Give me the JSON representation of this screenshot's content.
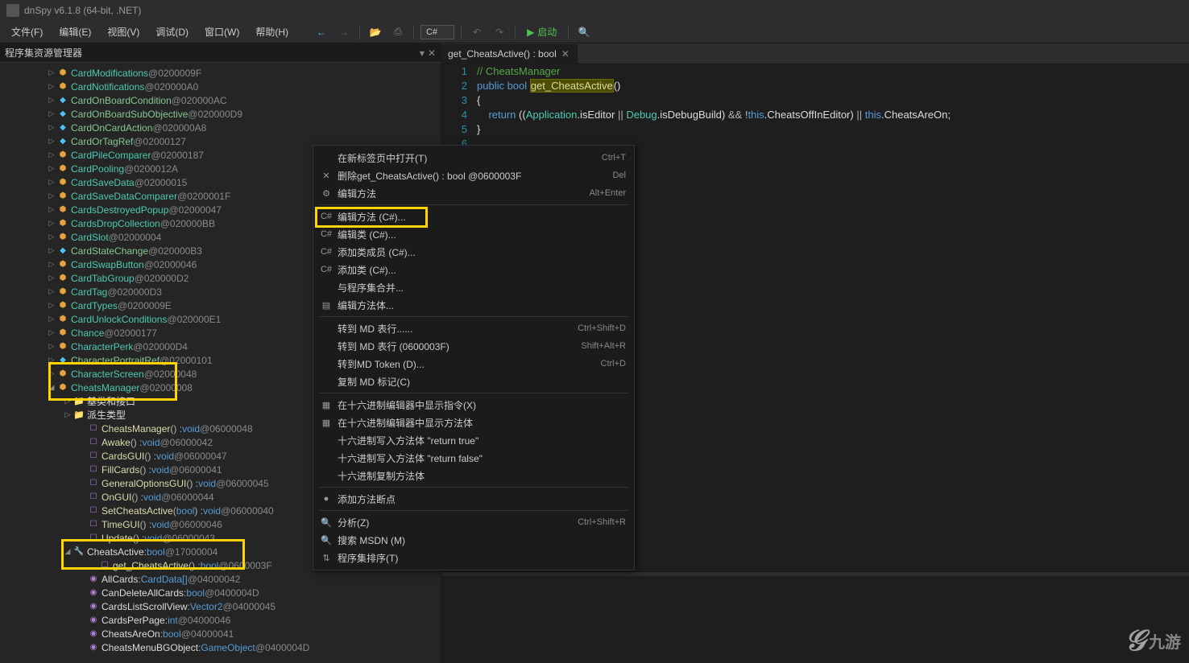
{
  "title": "dnSpy v6.1.8 (64-bit, .NET)",
  "menu": {
    "file": "文件(F)",
    "edit": "编辑(E)",
    "view": "视图(V)",
    "debug": "调试(D)",
    "window": "窗口(W)",
    "help": "帮助(H)"
  },
  "toolbar": {
    "lang": "C#",
    "start": "启动"
  },
  "sidebar": {
    "title": "程序集资源管理器"
  },
  "tree": [
    {
      "i": 58,
      "a": "▷",
      "t": "class",
      "n": "CardModifications",
      "m": "@0200009F"
    },
    {
      "i": 58,
      "a": "▷",
      "t": "class",
      "n": "CardNotifications",
      "m": "@020000A0"
    },
    {
      "i": 58,
      "a": "▷",
      "t": "struct",
      "n": "CardOnBoardCondition",
      "m": "@020000AC"
    },
    {
      "i": 58,
      "a": "▷",
      "t": "struct",
      "n": "CardOnBoardSubObjective",
      "m": "@020000D9"
    },
    {
      "i": 58,
      "a": "▷",
      "t": "struct",
      "n": "CardOnCardAction",
      "m": "@020000A8"
    },
    {
      "i": 58,
      "a": "▷",
      "t": "struct",
      "n": "CardOrTagRef",
      "m": "@02000127"
    },
    {
      "i": 58,
      "a": "▷",
      "t": "class",
      "n": "CardPileComparer",
      "m": "@02000187"
    },
    {
      "i": 58,
      "a": "▷",
      "t": "class",
      "n": "CardPooling",
      "m": "@0200012A"
    },
    {
      "i": 58,
      "a": "▷",
      "t": "class",
      "n": "CardSaveData",
      "m": "@02000015"
    },
    {
      "i": 58,
      "a": "▷",
      "t": "class",
      "n": "CardSaveDataComparer",
      "m": "@0200001F"
    },
    {
      "i": 58,
      "a": "▷",
      "t": "class",
      "n": "CardsDestroyedPopup",
      "m": "@02000047"
    },
    {
      "i": 58,
      "a": "▷",
      "t": "class",
      "n": "CardsDropCollection",
      "m": "@020000BB"
    },
    {
      "i": 58,
      "a": "▷",
      "t": "class",
      "n": "CardSlot",
      "m": "@02000004"
    },
    {
      "i": 58,
      "a": "▷",
      "t": "struct",
      "n": "CardStateChange",
      "m": "@020000B3"
    },
    {
      "i": 58,
      "a": "▷",
      "t": "class",
      "n": "CardSwapButton",
      "m": "@02000046"
    },
    {
      "i": 58,
      "a": "▷",
      "t": "class",
      "n": "CardTabGroup",
      "m": "@020000D2"
    },
    {
      "i": 58,
      "a": "▷",
      "t": "class",
      "n": "CardTag",
      "m": "@020000D3"
    },
    {
      "i": 58,
      "a": "▷",
      "t": "class",
      "n": "CardTypes",
      "m": "@0200009E"
    },
    {
      "i": 58,
      "a": "▷",
      "t": "class",
      "n": "CardUnlockConditions",
      "m": "@020000E1"
    },
    {
      "i": 58,
      "a": "▷",
      "t": "class",
      "n": "Chance",
      "m": "@02000177"
    },
    {
      "i": 58,
      "a": "▷",
      "t": "class",
      "n": "CharacterPerk",
      "m": "@020000D4"
    },
    {
      "i": 58,
      "a": "▷",
      "t": "struct",
      "n": "CharacterPortraitRef",
      "m": "@02000101"
    },
    {
      "i": 58,
      "a": "▷",
      "t": "class",
      "n": "CharacterScreen",
      "m": "@02000048"
    },
    {
      "i": 58,
      "a": "◢",
      "t": "class",
      "n": "CheatsManager",
      "m": "@02000008"
    },
    {
      "i": 78,
      "a": "▷",
      "t": "folder",
      "n": "基类和接口",
      "m": ""
    },
    {
      "i": 78,
      "a": "▷",
      "t": "folder",
      "n": "派生类型",
      "m": ""
    },
    {
      "i": 96,
      "a": "",
      "t": "method",
      "n": "CheatsManager",
      "sig": "() : ",
      "ret": "void",
      "m": "@06000048"
    },
    {
      "i": 96,
      "a": "",
      "t": "method",
      "n": "Awake",
      "sig": "() : ",
      "ret": "void",
      "m": "@06000042"
    },
    {
      "i": 96,
      "a": "",
      "t": "method",
      "n": "CardsGUI",
      "sig": "() : ",
      "ret": "void",
      "m": "@06000047"
    },
    {
      "i": 96,
      "a": "",
      "t": "method",
      "n": "FillCards",
      "sig": "() : ",
      "ret": "void",
      "m": "@06000041"
    },
    {
      "i": 96,
      "a": "",
      "t": "method",
      "n": "GeneralOptionsGUI",
      "sig": "() : ",
      "ret": "void",
      "m": "@06000045"
    },
    {
      "i": 96,
      "a": "",
      "t": "method",
      "n": "OnGUI",
      "sig": "() : ",
      "ret": "void",
      "m": "@06000044"
    },
    {
      "i": 96,
      "a": "",
      "t": "method",
      "n": "SetCheatsActive",
      "sig": "(",
      "arg": "bool",
      "sig2": ") : ",
      "ret": "void",
      "m": "@06000040"
    },
    {
      "i": 96,
      "a": "",
      "t": "method",
      "n": "TimeGUI",
      "sig": "() : ",
      "ret": "void",
      "m": "@06000046"
    },
    {
      "i": 96,
      "a": "",
      "t": "method",
      "n": "Update",
      "sig": "() : ",
      "ret": "void",
      "m": "@06000043"
    },
    {
      "i": 78,
      "a": "◢",
      "t": "prop",
      "n": "CheatsActive",
      "sep": " : ",
      "ret": "bool",
      "m": "@17000004"
    },
    {
      "i": 110,
      "a": "",
      "t": "method",
      "n": "get_CheatsActive",
      "sig": "() : ",
      "ret": "bool",
      "m": "@0600003F"
    },
    {
      "i": 96,
      "a": "",
      "t": "field",
      "n": "AllCards",
      "sep": " : ",
      "ret": "CardData[]",
      "m": "@04000042"
    },
    {
      "i": 96,
      "a": "",
      "t": "field",
      "n": "CanDeleteAllCards",
      "sep": " : ",
      "ret": "bool",
      "m": "@0400004D"
    },
    {
      "i": 96,
      "a": "",
      "t": "field",
      "n": "CardsListScrollView",
      "sep": " : ",
      "ret": "Vector2",
      "m": "@04000045"
    },
    {
      "i": 96,
      "a": "",
      "t": "field",
      "n": "CardsPerPage",
      "sep": " : ",
      "ret": "int",
      "m": "@04000046"
    },
    {
      "i": 96,
      "a": "",
      "t": "field",
      "n": "CheatsAreOn",
      "sep": " : ",
      "ret": "bool",
      "m": "@04000041"
    },
    {
      "i": 96,
      "a": "",
      "t": "field",
      "n": "CheatsMenuBGObject",
      "sep": " : ",
      "ret": "GameObject",
      "m": "@0400004D"
    }
  ],
  "tab": {
    "label": "get_CheatsActive() : bool"
  },
  "code": {
    "lines": [
      "1",
      "2",
      "3",
      "4",
      "5",
      "6"
    ],
    "l1": "// CheatsManager",
    "l2_kw": "public bool ",
    "l2_hl": "get_CheatsActive",
    "l2_paren": "()",
    "l3": "{",
    "l4": "    return ((Application.isEditor || Debug.isDebugBuild) && !this.CheatsOffInEditor) || this.CheatsAreOn;",
    "l5": "}",
    "l4_parts": {
      "kw": "return",
      "app": "Application",
      "ise": "isEditor",
      "dbg": "Debug",
      "isd": "isDebugBuild",
      "th": "this",
      "coie": "CheatsOffInEditor",
      "cao": "CheatsAreOn"
    }
  },
  "ctx": [
    {
      "ico": "",
      "label": "在新标签页中打开(T)",
      "sc": "Ctrl+T"
    },
    {
      "ico": "✕",
      "label": "删除get_CheatsActive() : bool @0600003F",
      "sc": "Del"
    },
    {
      "ico": "⚙",
      "label": "编辑方法",
      "sc": "Alt+Enter"
    },
    {
      "sep": true
    },
    {
      "ico": "C#",
      "label": "编辑方法 (C#)...",
      "sc": ""
    },
    {
      "ico": "C#",
      "label": "编辑类 (C#)...",
      "sc": ""
    },
    {
      "ico": "C#",
      "label": "添加类成员 (C#)...",
      "sc": ""
    },
    {
      "ico": "C#",
      "label": "添加类 (C#)...",
      "sc": ""
    },
    {
      "ico": "",
      "label": "与程序集合并...",
      "sc": ""
    },
    {
      "ico": "▤",
      "label": "编辑方法体...",
      "sc": ""
    },
    {
      "sep": true
    },
    {
      "ico": "",
      "label": "转到 MD 表行......",
      "sc": "Ctrl+Shift+D"
    },
    {
      "ico": "",
      "label": "转到 MD 表行 (0600003F)",
      "sc": "Shift+Alt+R"
    },
    {
      "ico": "",
      "label": "转到MD Token (D)...",
      "sc": "Ctrl+D"
    },
    {
      "ico": "",
      "label": "复制 MD 标记(C)",
      "sc": ""
    },
    {
      "sep": true
    },
    {
      "ico": "▦",
      "label": "在十六进制编辑器中显示指令(X)",
      "sc": ""
    },
    {
      "ico": "▦",
      "label": "在十六进制编辑器中显示方法体",
      "sc": ""
    },
    {
      "ico": "",
      "label": "十六进制写入方法体 \"return true\"",
      "sc": ""
    },
    {
      "ico": "",
      "label": "十六进制写入方法体 \"return false\"",
      "sc": ""
    },
    {
      "ico": "",
      "label": "十六进制复制方法体",
      "sc": ""
    },
    {
      "sep": true
    },
    {
      "ico": "●",
      "label": "添加方法断点",
      "sc": ""
    },
    {
      "sep": true
    },
    {
      "ico": "🔍",
      "label": "分析(Z)",
      "sc": "Ctrl+Shift+R"
    },
    {
      "ico": "🔍",
      "label": "搜索 MSDN (M)",
      "sc": ""
    },
    {
      "ico": "⇅",
      "label": "程序集排序(T)",
      "sc": ""
    }
  ],
  "watermark": {
    "brand": "九游"
  }
}
